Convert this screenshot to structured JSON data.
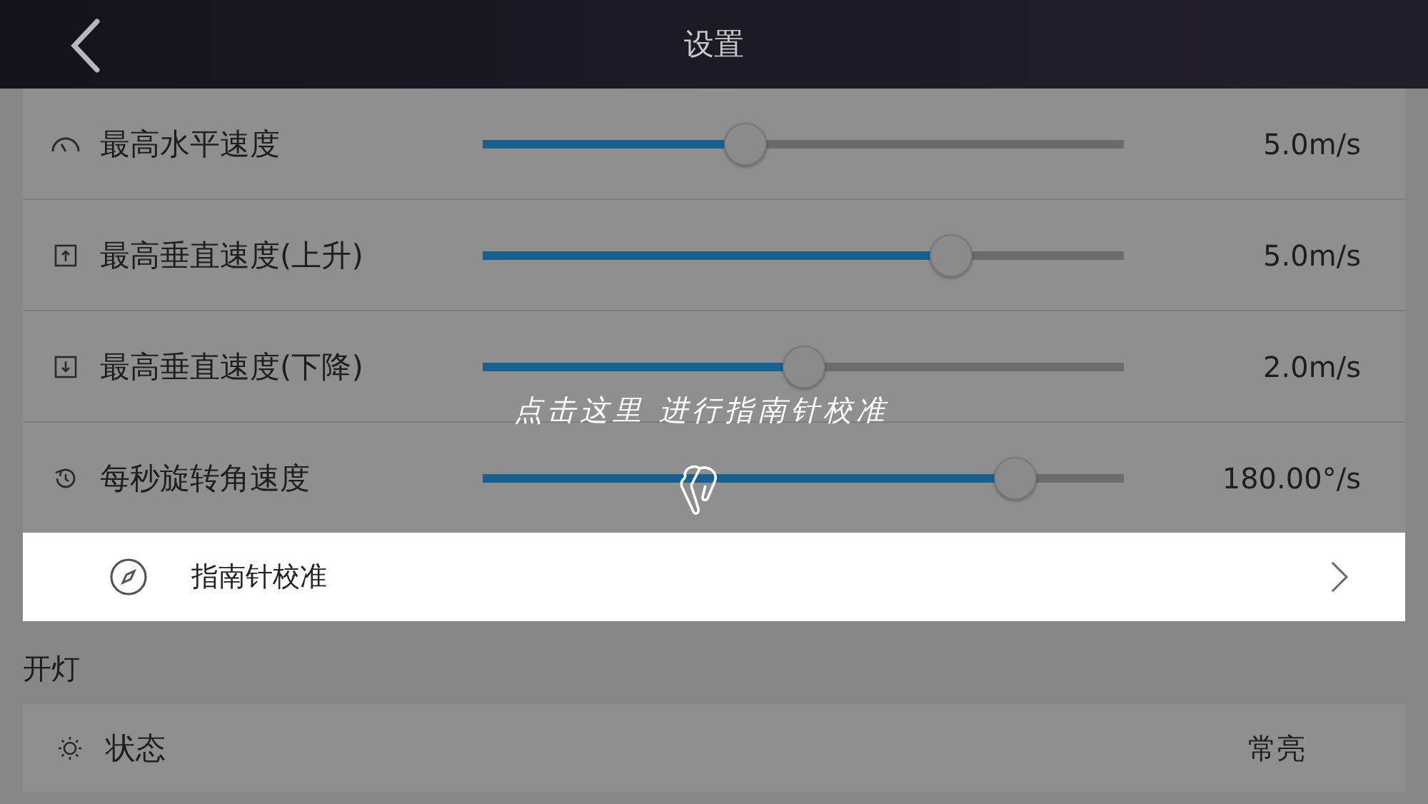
{
  "header": {
    "title": "设置"
  },
  "speed_settings": [
    {
      "kind": "gauge",
      "label": "最高水平速度",
      "level": 0.41,
      "reading": "5.0m/s"
    },
    {
      "kind": "up",
      "label": "最高垂直速度(上升)",
      "level": 0.73,
      "reading": "5.0m/s"
    },
    {
      "kind": "down",
      "label": "最高垂直速度(下降)",
      "level": 0.5,
      "reading": "2.0m/s"
    },
    {
      "kind": "rotate",
      "label": "每秒旋转角速度",
      "level": 0.83,
      "reading": "180.00°/s"
    }
  ],
  "compass_row": {
    "label": "指南针校准"
  },
  "hint": {
    "text": "点击这里 进行指南针校准"
  },
  "lights_section": {
    "title": "开灯",
    "rows": [
      {
        "label": "状态",
        "value": "常亮"
      }
    ]
  }
}
